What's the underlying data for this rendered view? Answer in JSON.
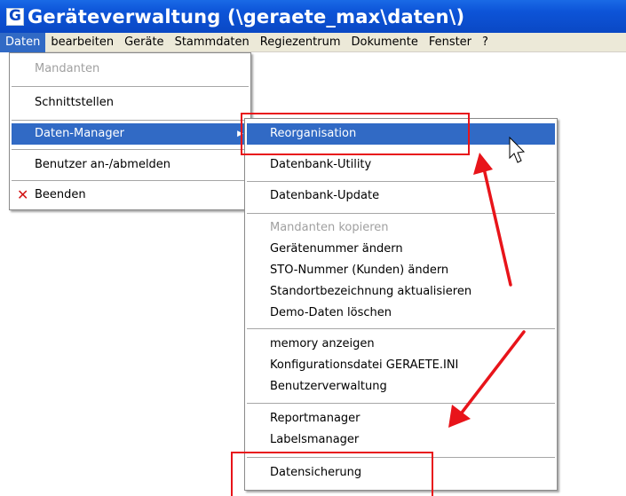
{
  "window": {
    "icon_letter": "G",
    "title": "Geräteverwaltung (\\geraete_max\\daten\\)"
  },
  "menubar": [
    "Daten",
    "bearbeiten",
    "Geräte",
    "Stammdaten",
    "Regiezentrum",
    "Dokumente",
    "Fenster",
    "?"
  ],
  "daten_menu": {
    "items": [
      "Mandanten",
      "Schnittstellen",
      "Daten-Manager",
      "Benutzer an-/abmelden",
      "Beenden"
    ],
    "submenu_arrow": "▶"
  },
  "submenu": {
    "items": [
      "Reorganisation",
      "Datenbank-Utility",
      "Datenbank-Update",
      "Mandanten kopieren",
      "Gerätenummer ändern",
      "STO-Nummer (Kunden) ändern",
      "Standortbezeichnung aktualisieren",
      "Demo-Daten löschen",
      "memory anzeigen",
      "Konfigurationsdatei GERAETE.INI",
      "Benutzerverwaltung",
      "Reportmanager",
      "Labelsmanager",
      "Datensicherung"
    ]
  },
  "annotation_color": "#e8141a",
  "icons": {
    "exit": "x-icon",
    "cursor": "mouse-cursor-icon",
    "arrows": "red-arrow"
  }
}
